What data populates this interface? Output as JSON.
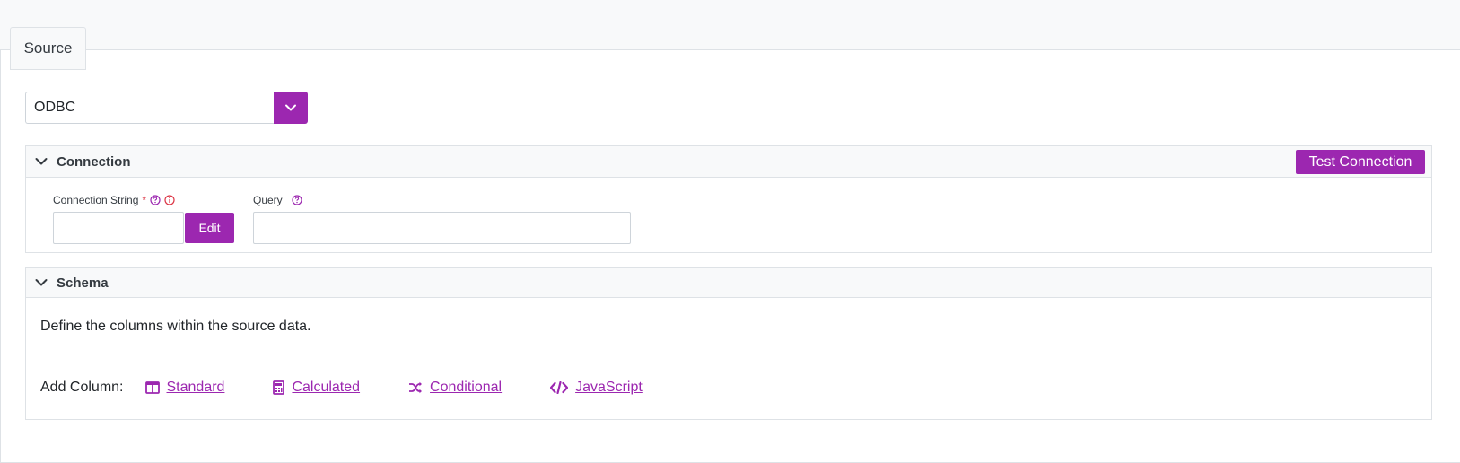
{
  "tab": {
    "label": "Source"
  },
  "source_select": {
    "value": "ODBC"
  },
  "connection": {
    "title": "Connection",
    "test_button": "Test Connection",
    "connection_string_label": "Connection String",
    "required_mark": "*",
    "edit_button": "Edit",
    "query_label": "Query",
    "connection_string_value": "",
    "query_value": ""
  },
  "schema": {
    "title": "Schema",
    "description": "Define the columns within the source data.",
    "add_column_label": "Add Column:",
    "links": {
      "standard": "Standard",
      "calculated": "Calculated",
      "conditional": "Conditional",
      "javascript": "JavaScript"
    }
  },
  "icons": {
    "chevron": "chevron-down-icon",
    "help": "question-circle-icon",
    "info": "info-circle-icon",
    "standard": "table-columns-icon",
    "calculated": "calculator-icon",
    "conditional": "shuffle-icon",
    "javascript": "code-icon"
  },
  "colors": {
    "accent": "#9c27b0",
    "required": "#dc3545",
    "border": "#dee2e6"
  }
}
